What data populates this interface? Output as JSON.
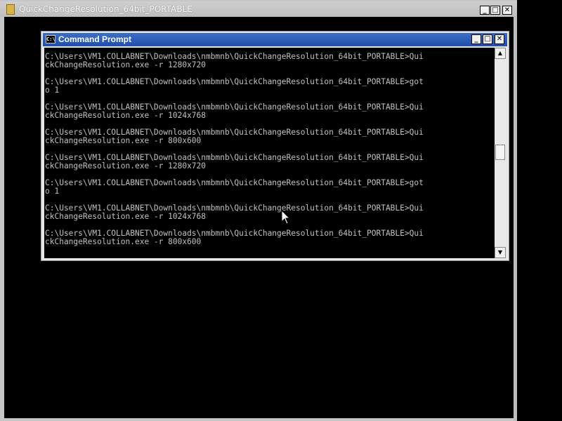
{
  "outer_window": {
    "title": "QuickChangeResolution_64bit_PORTABLE",
    "buttons": {
      "minimize": "_",
      "maximize": "□",
      "close": "✕"
    }
  },
  "cmd_window": {
    "title": "Command Prompt",
    "icon_text": "C:\\",
    "buttons": {
      "minimize": "_",
      "maximize": "□",
      "close": "✕"
    },
    "lines": [
      "C:\\Users\\VM1.COLLABNET\\Downloads\\nmbmnb\\QuickChangeResolution_64bit_PORTABLE>Qui",
      "ckChangeResolution.exe -r 1280x720",
      "",
      "C:\\Users\\VM1.COLLABNET\\Downloads\\nmbmnb\\QuickChangeResolution_64bit_PORTABLE>got",
      "o 1",
      "",
      "C:\\Users\\VM1.COLLABNET\\Downloads\\nmbmnb\\QuickChangeResolution_64bit_PORTABLE>Qui",
      "ckChangeResolution.exe -r 1024x768",
      "",
      "C:\\Users\\VM1.COLLABNET\\Downloads\\nmbmnb\\QuickChangeResolution_64bit_PORTABLE>Qui",
      "ckChangeResolution.exe -r 800x600",
      "",
      "C:\\Users\\VM1.COLLABNET\\Downloads\\nmbmnb\\QuickChangeResolution_64bit_PORTABLE>Qui",
      "ckChangeResolution.exe -r 1280x720",
      "",
      "C:\\Users\\VM1.COLLABNET\\Downloads\\nmbmnb\\QuickChangeResolution_64bit_PORTABLE>got",
      "o 1",
      "",
      "C:\\Users\\VM1.COLLABNET\\Downloads\\nmbmnb\\QuickChangeResolution_64bit_PORTABLE>Qui",
      "ckChangeResolution.exe -r 1024x768",
      "",
      "C:\\Users\\VM1.COLLABNET\\Downloads\\nmbmnb\\QuickChangeResolution_64bit_PORTABLE>Qui",
      "ckChangeResolution.exe -r 800x600"
    ],
    "scrollbar": {
      "up_arrow": "▲",
      "down_arrow": "▼"
    }
  },
  "colors": {
    "console_bg": "#000000",
    "console_text": "#c0c0c0",
    "cmd_titlebar": "#2a5cb8",
    "outer_titlebar": "#c6c6c6"
  },
  "icons": {
    "outer_title_icon": "folder-icon",
    "cmd_title_icon": "console-icon",
    "cursor": "arrow-cursor-icon"
  }
}
